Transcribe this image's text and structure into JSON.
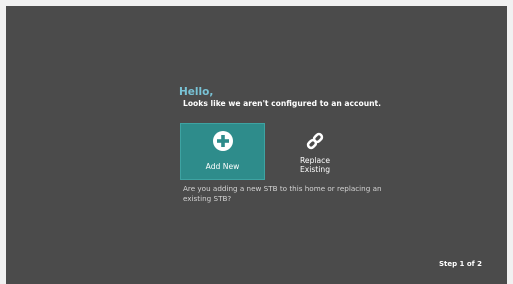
{
  "greeting": "Hello,",
  "message": "Looks like we aren't configured to an account.",
  "options": {
    "add_new": {
      "label": "Add New",
      "icon": "plus-circle-icon"
    },
    "replace_existing": {
      "label": "Replace Existing",
      "icon": "link-icon"
    }
  },
  "question": "Are you adding a new STB to this home or replacing an existing STB?",
  "step": "Step 1 of 2",
  "colors": {
    "accent": "#2e8c8b",
    "greeting": "#79c3d6",
    "background": "#4b4b4b"
  }
}
